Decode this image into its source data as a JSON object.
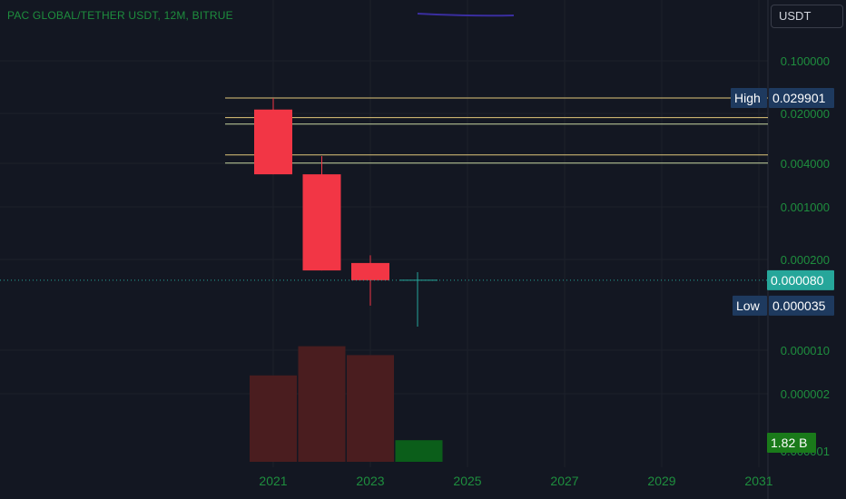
{
  "header": {
    "title": "PAC GLOBAL/TETHER USDT, 12M, BITRUE",
    "currency": "USDT"
  },
  "colors": {
    "background": "#131722",
    "bear": "#f23645",
    "bull": "#089981",
    "volume_bear": "#4a1d1f",
    "volume_bull": "#0b5e1a",
    "level_line": "#e0c77a",
    "level_line_alt": "#c8d6a0",
    "title": "#1e8e3e",
    "axis_text": "#1e8e3e",
    "label_bg": "#1e3a5f",
    "last_price_bg": "#26a69a",
    "volume_label_bg": "#1a7a1a"
  },
  "chart_data": {
    "type": "candlestick",
    "y_scale": "log",
    "y_ticks": [
      "0.100000",
      "0.020000",
      "0.004000",
      "0.001000",
      "0.000200",
      "0.000010",
      "0.000002",
      "0.000001"
    ],
    "x_ticks": [
      "2021",
      "2023",
      "2025",
      "2027",
      "2029",
      "2031"
    ],
    "candles": [
      {
        "year": 2021,
        "open": 0.0205,
        "high": 0.029901,
        "low": 0.0025,
        "close": 0.0025,
        "volume_relative": 0.68
      },
      {
        "year": 2022,
        "open": 0.0025,
        "high": 0.0045,
        "low": 0.00011,
        "close": 0.00011,
        "volume_relative": 0.91
      },
      {
        "year": 2023,
        "open": 0.00014,
        "high": 0.00018,
        "low": 3.5e-05,
        "close": 8e-05,
        "volume_relative": 0.84
      }
    ],
    "volume_bars": [
      {
        "year": 2021,
        "direction": "down",
        "relative": 0.68
      },
      {
        "year": 2022,
        "direction": "down",
        "relative": 0.91
      },
      {
        "year": 2023,
        "direction": "down",
        "relative": 0.84
      },
      {
        "year": 2024,
        "direction": "up",
        "relative": 0.17
      }
    ],
    "level_lines": [
      0.029901,
      0.0158,
      0.0128,
      0.0047,
      0.0036
    ],
    "high": {
      "label": "High",
      "value": "0.029901"
    },
    "low": {
      "label": "Low",
      "value": "0.000035"
    },
    "last_price": "0.000080",
    "volume_label": "1.82 B"
  }
}
